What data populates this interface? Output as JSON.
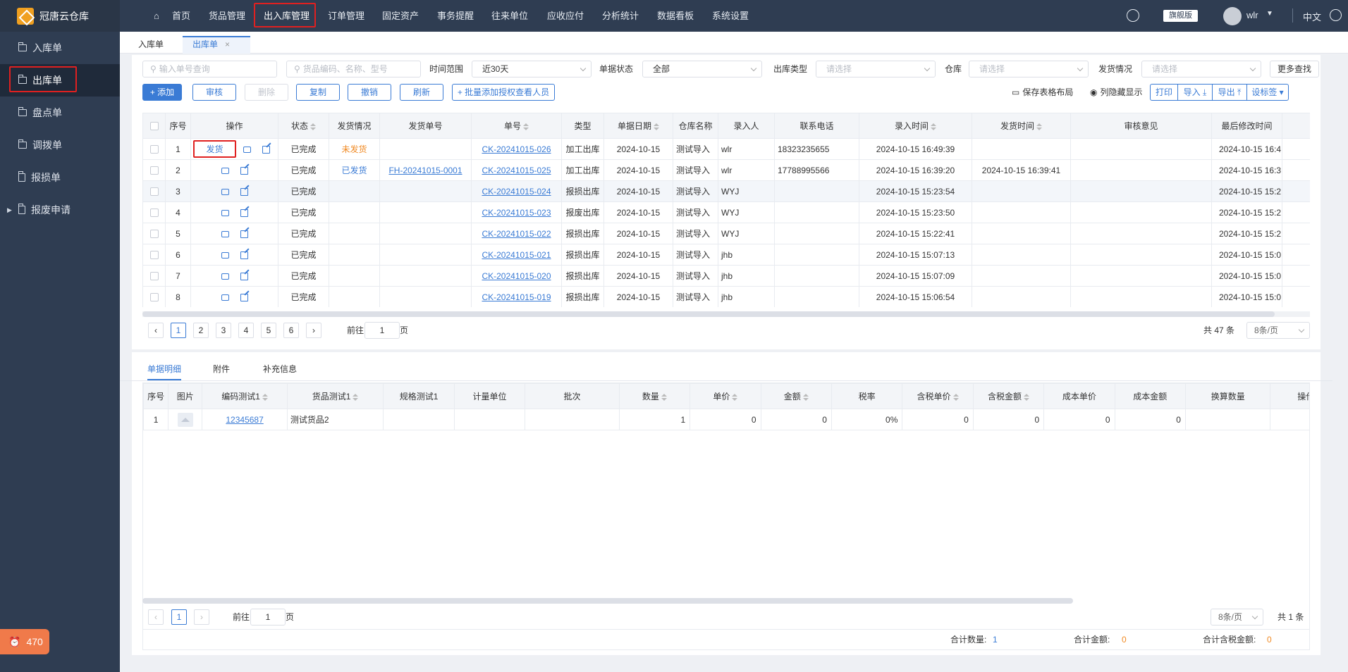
{
  "app": {
    "title": "冠唐云仓库",
    "edition": "旗舰版",
    "user": "wlr",
    "language": "中文"
  },
  "sidebar": {
    "items": [
      {
        "label": "入库单"
      },
      {
        "label": "出库单"
      },
      {
        "label": "盘点单"
      },
      {
        "label": "调拨单"
      },
      {
        "label": "报损单"
      },
      {
        "label": "报废申请"
      }
    ],
    "badge": "470"
  },
  "topnav": [
    "首页",
    "货品管理",
    "出入库管理",
    "订单管理",
    "固定资产",
    "事务提醒",
    "往来单位",
    "应收应付",
    "分析统计",
    "数据看板",
    "系统设置"
  ],
  "tabs": [
    {
      "label": "入库单"
    },
    {
      "label": "出库单",
      "close": "×"
    }
  ],
  "filters": {
    "order_no_ph": "输入单号查询",
    "goods_ph": "货品编码、名称、型号",
    "time_label": "时间范围",
    "time_value": "近30天",
    "status_label": "单据状态",
    "status_value": "全部",
    "type_label": "出库类型",
    "type_ph": "请选择",
    "wh_label": "仓库",
    "wh_ph": "请选择",
    "ship_label": "发货情况",
    "ship_ph": "请选择",
    "more": "更多查找"
  },
  "toolbar": {
    "add": "+ 添加",
    "audit": "审核",
    "delete": "删除",
    "copy": "复制",
    "revoke": "撤销",
    "refresh": "刷新",
    "batch": "+ 批量添加授权查看人员",
    "save_layout": "保存表格布局",
    "col_hide": "列隐藏显示",
    "print": "打印",
    "import": "导入",
    "export": "导出",
    "set_tag": "设标签"
  },
  "table": {
    "headers": [
      "序号",
      "操作",
      "状态",
      "发货情况",
      "发货单号",
      "单号",
      "类型",
      "单据日期",
      "仓库名称",
      "录入人",
      "联系电话",
      "录入时间",
      "发货时间",
      "审核意见",
      "最后修改时间"
    ],
    "ship_btn": "发货",
    "rows": [
      {
        "no": "1",
        "status": "已完成",
        "ship": "未发货",
        "ship_no": "",
        "order": "CK-20241015-026",
        "type": "加工出库",
        "date": "2024-10-15",
        "wh": "测试导入",
        "user": "wlr",
        "phone": "18323235655",
        "in_time": "2024-10-15 16:49:39",
        "ship_time": "",
        "remark": "",
        "mod": "2024-10-15 16:4"
      },
      {
        "no": "2",
        "status": "已完成",
        "ship": "已发货",
        "ship_no": "FH-20241015-0001",
        "order": "CK-20241015-025",
        "type": "加工出库",
        "date": "2024-10-15",
        "wh": "测试导入",
        "user": "wlr",
        "phone": "17788995566",
        "in_time": "2024-10-15 16:39:20",
        "ship_time": "2024-10-15 16:39:41",
        "remark": "",
        "mod": "2024-10-15 16:3"
      },
      {
        "no": "3",
        "status": "已完成",
        "ship": "",
        "ship_no": "",
        "order": "CK-20241015-024",
        "type": "报损出库",
        "date": "2024-10-15",
        "wh": "测试导入",
        "user": "WYJ",
        "phone": "",
        "in_time": "2024-10-15 15:23:54",
        "ship_time": "",
        "remark": "",
        "mod": "2024-10-15 15:2"
      },
      {
        "no": "4",
        "status": "已完成",
        "ship": "",
        "ship_no": "",
        "order": "CK-20241015-023",
        "type": "报废出库",
        "date": "2024-10-15",
        "wh": "测试导入",
        "user": "WYJ",
        "phone": "",
        "in_time": "2024-10-15 15:23:50",
        "ship_time": "",
        "remark": "",
        "mod": "2024-10-15 15:2"
      },
      {
        "no": "5",
        "status": "已完成",
        "ship": "",
        "ship_no": "",
        "order": "CK-20241015-022",
        "type": "报损出库",
        "date": "2024-10-15",
        "wh": "测试导入",
        "user": "WYJ",
        "phone": "",
        "in_time": "2024-10-15 15:22:41",
        "ship_time": "",
        "remark": "",
        "mod": "2024-10-15 15:2"
      },
      {
        "no": "6",
        "status": "已完成",
        "ship": "",
        "ship_no": "",
        "order": "CK-20241015-021",
        "type": "报损出库",
        "date": "2024-10-15",
        "wh": "测试导入",
        "user": "jhb",
        "phone": "",
        "in_time": "2024-10-15 15:07:13",
        "ship_time": "",
        "remark": "",
        "mod": "2024-10-15 15:0"
      },
      {
        "no": "7",
        "status": "已完成",
        "ship": "",
        "ship_no": "",
        "order": "CK-20241015-020",
        "type": "报损出库",
        "date": "2024-10-15",
        "wh": "测试导入",
        "user": "jhb",
        "phone": "",
        "in_time": "2024-10-15 15:07:09",
        "ship_time": "",
        "remark": "",
        "mod": "2024-10-15 15:0"
      },
      {
        "no": "8",
        "status": "已完成",
        "ship": "",
        "ship_no": "",
        "order": "CK-20241015-019",
        "type": "报损出库",
        "date": "2024-10-15",
        "wh": "测试导入",
        "user": "jhb",
        "phone": "",
        "in_time": "2024-10-15 15:06:54",
        "ship_time": "",
        "remark": "",
        "mod": "2024-10-15 15:0"
      }
    ]
  },
  "pagination": {
    "pages": [
      "1",
      "2",
      "3",
      "4",
      "5",
      "6"
    ],
    "goto_pre": "前往",
    "goto_val": "1",
    "goto_post": "页",
    "total": "共 47 条",
    "size": "8条/页"
  },
  "detail": {
    "tabs": [
      "单据明细",
      "附件",
      "补充信息"
    ],
    "headers": [
      "序号",
      "图片",
      "编码测试1",
      "货品测试1",
      "规格测试1",
      "计量单位",
      "批次",
      "数量",
      "单价",
      "金额",
      "税率",
      "含税单价",
      "含税金额",
      "成本单价",
      "成本金额",
      "换算数量",
      "操作"
    ],
    "rows": [
      {
        "no": "1",
        "code": "12345687",
        "name": "测试货品2",
        "spec": "",
        "unit": "",
        "batch": "",
        "qty": "1",
        "price": "0",
        "amount": "0",
        "tax": "0%",
        "tprice": "0",
        "tamount": "0",
        "cprice": "0",
        "camount": "0",
        "conv": "",
        "op": ""
      }
    ],
    "pager": {
      "page": "1",
      "goto_pre": "前往",
      "goto_val": "1",
      "goto_post": "页",
      "size": "8条/页",
      "total": "共 1 条"
    },
    "summary": {
      "qty_label": "合计数量:",
      "qty": "1",
      "amt_label": "合计金额:",
      "amt": "0",
      "tamt_label": "合计含税金额:",
      "tamt": "0"
    }
  }
}
